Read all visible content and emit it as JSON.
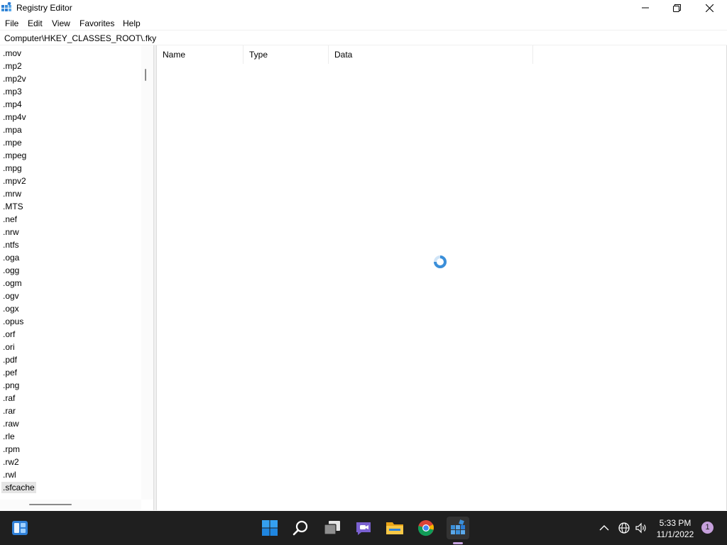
{
  "window": {
    "title": "Registry Editor"
  },
  "menu": [
    {
      "label": "File"
    },
    {
      "label": "Edit"
    },
    {
      "label": "View"
    },
    {
      "label": "Favorites"
    },
    {
      "label": "Help"
    }
  ],
  "address_bar": {
    "path": "Computer\\HKEY_CLASSES_ROOT\\.fky"
  },
  "tree": {
    "items": [
      ".mov",
      ".mp2",
      ".mp2v",
      ".mp3",
      ".mp4",
      ".mp4v",
      ".mpa",
      ".mpe",
      ".mpeg",
      ".mpg",
      ".mpv2",
      ".mrw",
      ".MTS",
      ".nef",
      ".nrw",
      ".ntfs",
      ".oga",
      ".ogg",
      ".ogm",
      ".ogv",
      ".ogx",
      ".opus",
      ".orf",
      ".ori",
      ".pdf",
      ".pef",
      ".png",
      ".raf",
      ".rar",
      ".raw",
      ".rle",
      ".rpm",
      ".rw2",
      ".rwl",
      ".sfcache"
    ],
    "selected": ".sfcache"
  },
  "values_table": {
    "columns": [
      {
        "label": "Name"
      },
      {
        "label": "Type"
      },
      {
        "label": "Data"
      }
    ],
    "rows": []
  },
  "status": {
    "loading_indicator": "spinner-icon"
  },
  "taskbar": {
    "icons": [
      "widgets-icon",
      "start-icon",
      "search-icon",
      "task-view-icon",
      "chat-icon",
      "file-explorer-icon",
      "chrome-icon",
      "registry-editor-icon"
    ],
    "tray": [
      "chevron-up-icon",
      "network-icon",
      "volume-icon"
    ],
    "clock": {
      "time": "5:33 PM",
      "date": "11/1/2022"
    },
    "notification_count": "1"
  },
  "colors": {
    "taskbar_bg": "#1f1f1f",
    "accent_blue": "#3b8fd9",
    "selection_bg": "#e5e5e5",
    "badge": "#c6a0dc"
  }
}
